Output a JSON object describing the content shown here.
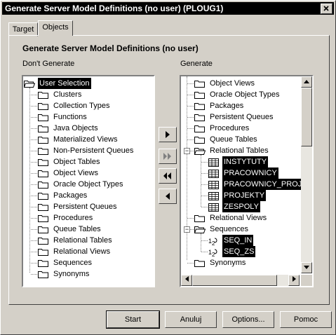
{
  "window": {
    "title": "Generate Server Model Definitions (no user)  (PLOUG1)"
  },
  "tabs": [
    {
      "label": "Target"
    },
    {
      "label": "Objects"
    }
  ],
  "heading": "Generate Server Model Definitions (no user)",
  "left": {
    "label": "Don't Generate",
    "root": "User Selection",
    "items": [
      "Clusters",
      "Collection Types",
      "Functions",
      "Java Objects",
      "Materialized Views",
      "Non-Persistent Queues",
      "Object Tables",
      "Object Views",
      "Oracle Object Types",
      "Packages",
      "Persistent Queues",
      "Procedures",
      "Queue Tables",
      "Relational Tables",
      "Relational Views",
      "Sequences",
      "Synonyms"
    ]
  },
  "right": {
    "label": "Generate",
    "folders_top": [
      "Object Views",
      "Oracle Object Types",
      "Packages",
      "Persistent Queues",
      "Procedures",
      "Queue Tables"
    ],
    "relational_tables": {
      "label": "Relational Tables",
      "children": [
        "INSTYTUTY",
        "PRACOWNICY",
        "PRACOWNICY_PROJ",
        "PROJEKTY",
        "ZESPOLY"
      ]
    },
    "relational_views": "Relational Views",
    "sequences": {
      "label": "Sequences",
      "children": [
        "SEQ_IN",
        "SEQ_ZS"
      ]
    },
    "synonyms": "Synonyms"
  },
  "move_buttons": [
    "▶",
    "▶▶",
    "◀◀",
    "◀"
  ],
  "buttons": {
    "start": "Start",
    "cancel": "Anuluj",
    "options": "Options...",
    "help": "Pomoc"
  },
  "icons": [
    "close-icon",
    "folder-icon",
    "folder-open-icon",
    "table-icon",
    "sequence-icon",
    "arrow-right-icon",
    "arrow-right-all-icon",
    "arrow-left-all-icon",
    "arrow-left-icon",
    "scroll-up-icon",
    "scroll-down-icon",
    "scroll-left-icon",
    "scroll-right-icon"
  ]
}
